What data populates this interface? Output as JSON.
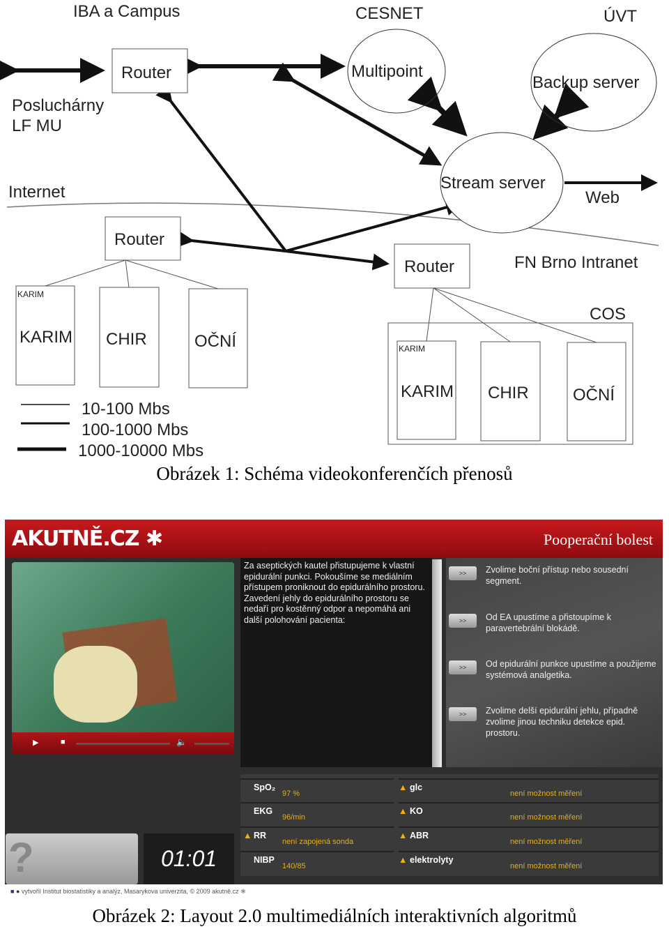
{
  "figure1": {
    "labels": {
      "campus": "IBA a Campus",
      "cesnet": "CESNET",
      "uvt": "ÚVT",
      "router": "Router",
      "multipoint": "Multipoint",
      "backup": "Backup server",
      "stream": "Stream server",
      "posluch1": "Posluchárny",
      "posluch2": "LF MU",
      "internet": "Internet",
      "web": "Web",
      "intranet": "FN Brno Intranet",
      "cos": "COS",
      "karim_small": "KARIM",
      "karim": "KARIM",
      "chir": "CHIR",
      "ocni": "OČNÍ"
    },
    "legend": [
      "10-100 Mbs",
      "100-1000 Mbs",
      "1000-10000 Mbs"
    ],
    "caption": "Obrázek 1: Schéma videokonferenčích přenosů"
  },
  "figure2": {
    "logo": "AKUTNĚ.CZ",
    "title": "Pooperační bolest",
    "text": "Za aseptických kautel přistupujeme k vlastní epidurální punkci. Pokoušíme se mediálním přístupem proniknout do epidurálního prostoru. Zavedení jehly do epidurálního prostoru se nedaří pro kostěnný odpor a nepomáhá ani další polohování pacienta:",
    "button_label": ">>",
    "options": [
      "Zvolime boční přístup nebo sousední segment.",
      "Od EA upustíme a přistoupíme k paravertebrální blokádě.",
      "Od epidurální punkce upustíme a použijeme systémová analgetika.",
      "Zvolime delší epidurální jehlu, případně zvolime jinou techniku detekce epid. prostoru."
    ],
    "vitals_left": [
      {
        "label": "SpO₂",
        "value": "97 %",
        "warn": false
      },
      {
        "label": "EKG",
        "value": "96/min",
        "warn": false
      },
      {
        "label": "RR",
        "value": "není zapojená sonda",
        "warn": true
      },
      {
        "label": "NIBP",
        "value": "140/85",
        "warn": false
      }
    ],
    "vitals_right": [
      {
        "label": "glc",
        "value": "není možnost měření"
      },
      {
        "label": "KO",
        "value": "není možnost měření"
      },
      {
        "label": "ABR",
        "value": "není možnost měření"
      },
      {
        "label": "elektrolyty",
        "value": "není možnost měření"
      }
    ],
    "help": "?",
    "timer": "01:01",
    "footer": "vytvořil Institut biostatistiky a analýz, Masarykova univerzita, © 2009 akutně.cz",
    "caption": "Obrázek 2: Layout 2.0 multimediálních interaktivních algoritmů"
  }
}
